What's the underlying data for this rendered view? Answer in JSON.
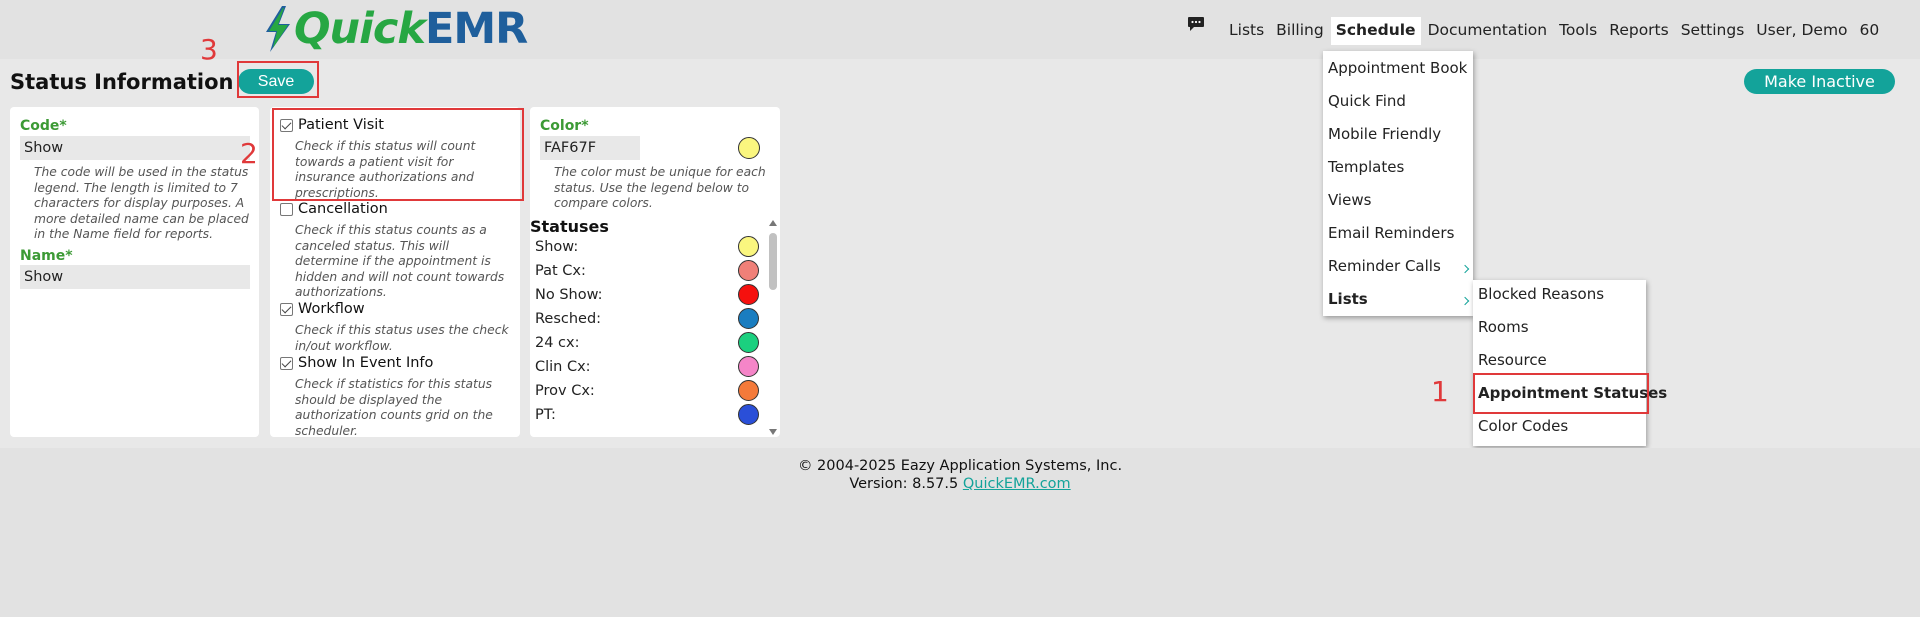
{
  "app": {
    "logo_quick": "Quick",
    "logo_emr": "EMR"
  },
  "nav": {
    "items": [
      "Lists",
      "Billing",
      "Schedule",
      "Documentation",
      "Tools",
      "Reports",
      "Settings",
      "User, Demo",
      "60"
    ],
    "active": "Schedule",
    "chat_icon": "chat-bubble-icon"
  },
  "page": {
    "title": "Status Information",
    "save_label": "Save",
    "make_inactive_label": "Make Inactive"
  },
  "code_panel": {
    "code_label": "Code*",
    "code_value": "Show",
    "code_help": "The code will be used in the status legend. The length is limited to 7 characters for display purposes. A more detailed name can be placed in the Name field for reports.",
    "name_label": "Name*",
    "name_value": "Show"
  },
  "options_panel": {
    "options": [
      {
        "label": "Patient Visit",
        "checked": true,
        "help": "Check if this status will count towards a patient visit for insurance authorizations and prescriptions."
      },
      {
        "label": "Cancellation",
        "checked": false,
        "help": "Check if this status counts as a canceled status. This will determine if the appointment is hidden and will not count towards authorizations."
      },
      {
        "label": "Workflow",
        "checked": true,
        "help": "Check if this status uses the check in/out workflow."
      },
      {
        "label": "Show In Event Info",
        "checked": true,
        "help": "Check if statistics for this status should be displayed the authorization counts grid on the scheduler."
      }
    ]
  },
  "color_panel": {
    "color_label": "Color*",
    "color_value": "FAF67F",
    "color_swatch": "#FAF67F",
    "color_help": "The color must be unique for each status. Use the legend below to compare colors.",
    "statuses_title": "Statuses",
    "statuses": [
      {
        "name": "Show:",
        "color": "#FAF67F"
      },
      {
        "name": "Pat Cx:",
        "color": "#F08078"
      },
      {
        "name": "No Show:",
        "color": "#F5100E"
      },
      {
        "name": "Resched:",
        "color": "#1A7DC0"
      },
      {
        "name": "24 cx:",
        "color": "#1BD07F"
      },
      {
        "name": "Clin Cx:",
        "color": "#F585C8"
      },
      {
        "name": "Prov Cx:",
        "color": "#F47A3A"
      },
      {
        "name": "PT:",
        "color": "#2A4FD8"
      }
    ]
  },
  "schedule_menu": {
    "items": [
      "Appointment Book",
      "Quick Find",
      "Mobile Friendly",
      "Templates",
      "Views",
      "Email Reminders",
      "Reminder Calls",
      "Lists"
    ]
  },
  "lists_submenu": {
    "items": [
      "Blocked Reasons",
      "Rooms",
      "Resource",
      "Appointment Statuses",
      "Color Codes"
    ]
  },
  "annotations": {
    "one": "1",
    "two": "2",
    "three": "3",
    "highlight_color": "#E0393A"
  },
  "footer": {
    "copyright": "© 2004-2025 Eazy Application Systems, Inc.",
    "version_prefix": "Version: 8.57.5",
    "link": "QuickEMR.com"
  },
  "colors": {
    "accent": "#13A39A",
    "label_green": "#3C9A35"
  }
}
